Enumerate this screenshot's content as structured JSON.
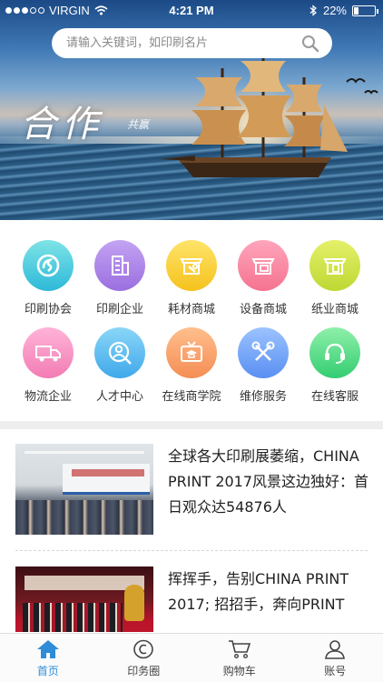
{
  "status_bar": {
    "carrier": "VIRGIN",
    "time": "4:21 PM",
    "battery": "22%",
    "battery_level": 0.22
  },
  "search": {
    "placeholder": "请输入关键词，如印刷名片",
    "icon": "search-icon"
  },
  "banner": {
    "title": "合作",
    "subtitle": "共赢"
  },
  "menu": [
    {
      "label": "印刷协会",
      "icon": "association-icon",
      "color_from": "#7ee3e6",
      "color_to": "#2db9d8"
    },
    {
      "label": "印刷企业",
      "icon": "building-icon",
      "color_from": "#c4a3f2",
      "color_to": "#9a6fe0"
    },
    {
      "label": "耗材商城",
      "icon": "shop-wrench-icon",
      "color_from": "#ffe36b",
      "color_to": "#f5c21c"
    },
    {
      "label": "设备商城",
      "icon": "shop-equipment-icon",
      "color_from": "#ffa5bc",
      "color_to": "#f4738f"
    },
    {
      "label": "纸业商城",
      "icon": "shop-paper-icon",
      "color_from": "#e4f06a",
      "color_to": "#bfd833"
    },
    {
      "label": "物流企业",
      "icon": "truck-icon",
      "color_from": "#ffb3d7",
      "color_to": "#f27cb4"
    },
    {
      "label": "人才中心",
      "icon": "person-search-icon",
      "color_from": "#8ad6f7",
      "color_to": "#3fa8ea"
    },
    {
      "label": "在线商学院",
      "icon": "tv-graduation-icon",
      "color_from": "#ffbf8c",
      "color_to": "#f58d55"
    },
    {
      "label": "维修服务",
      "icon": "tools-icon",
      "color_from": "#9bc3ff",
      "color_to": "#5a8ff2"
    },
    {
      "label": "在线客服",
      "icon": "headset-icon",
      "color_from": "#8ff0a9",
      "color_to": "#33cd72"
    }
  ],
  "news": [
    {
      "title": "全球各大印刷展萎缩，CHINA PRINT 2017风景这边独好：首日观众达54876人"
    },
    {
      "title": "挥挥手，告别CHINA PRINT 2017; 招招手，奔向PRINT"
    }
  ],
  "tabs": [
    {
      "label": "首页",
      "icon": "home-icon",
      "active": true
    },
    {
      "label": "印务圈",
      "icon": "circle-icon",
      "active": false
    },
    {
      "label": "购物车",
      "icon": "cart-icon",
      "active": false
    },
    {
      "label": "账号",
      "icon": "user-icon",
      "active": false
    }
  ],
  "colors": {
    "accent": "#2f8cd8",
    "text": "#222222",
    "divider": "#eeeeee"
  }
}
